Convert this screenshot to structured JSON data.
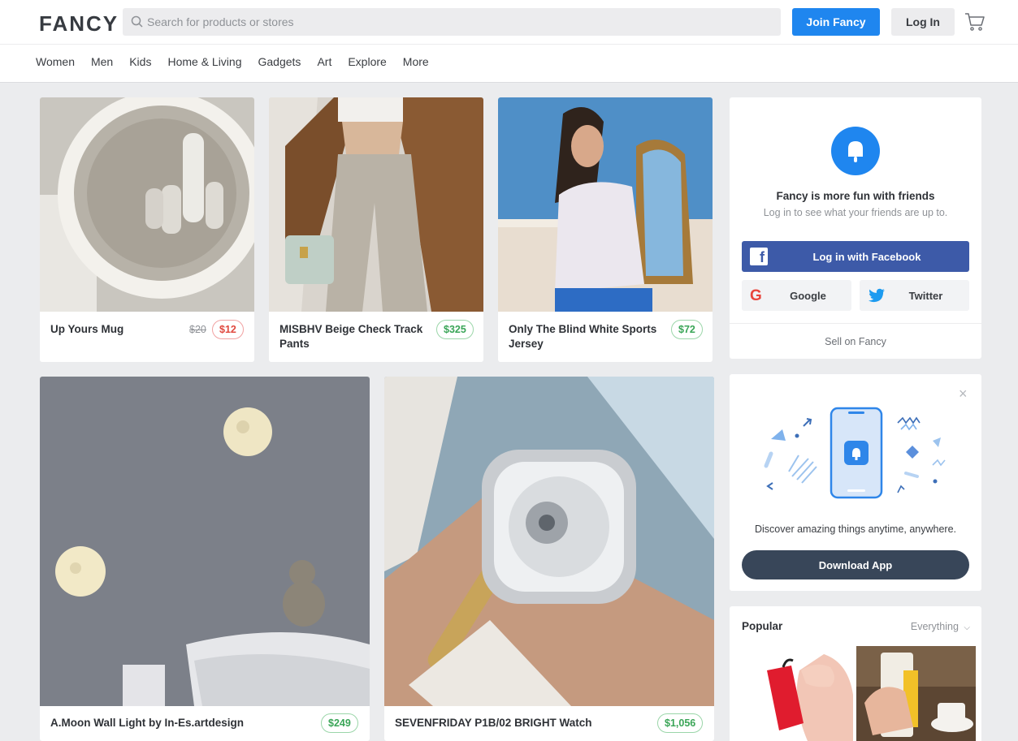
{
  "header": {
    "logo": "FANCY",
    "search_placeholder": "Search for products or stores",
    "join_label": "Join Fancy",
    "login_label": "Log In"
  },
  "nav": [
    "Women",
    "Men",
    "Kids",
    "Home & Living",
    "Gadgets",
    "Art",
    "Explore",
    "More"
  ],
  "products": [
    {
      "title": "Up Yours Mug",
      "old_price": "$20",
      "price": "$12",
      "sale": true
    },
    {
      "title": "MISBHV Beige Check Track",
      "title2": "Pants",
      "price": "$325"
    },
    {
      "title": "Only The Blind White Sports",
      "title2": "Jersey",
      "price": "$72"
    },
    {
      "title": "A.Moon Wall Light by In-Es.artdesign",
      "price": "$249"
    },
    {
      "title": "SEVENFRIDAY P1B/02 BRIGHT Watch",
      "price": "$1,056"
    }
  ],
  "login_panel": {
    "headline": "Fancy is more fun with friends",
    "subtext": "Log in to see what your friends are up to.",
    "facebook_label": "Log in with Facebook",
    "google_label": "Google",
    "twitter_label": "Twitter",
    "sell_label": "Sell on Fancy"
  },
  "app_panel": {
    "text": "Discover amazing things anytime, anywhere.",
    "download_label": "Download App"
  },
  "popular": {
    "title": "Popular",
    "filter": "Everything"
  },
  "colors": {
    "brand_blue": "#1f86ef",
    "facebook": "#3d5aa8",
    "price_green": "#3aa557",
    "price_red": "#e0483e"
  }
}
